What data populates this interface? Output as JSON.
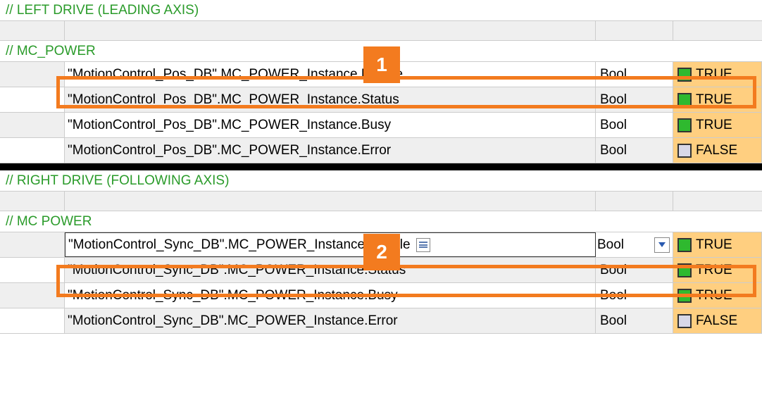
{
  "sections": {
    "left": {
      "title": "// LEFT DRIVE (LEADING AXIS)",
      "group_label": "// MC_POWER",
      "rows": [
        {
          "name": "\"MotionControl_Pos_DB\".MC_POWER_Instance.Enable",
          "type": "Bool",
          "value": "TRUE",
          "state": true
        },
        {
          "name": "\"MotionControl_Pos_DB\".MC_POWER_Instance.Status",
          "type": "Bool",
          "value": "TRUE",
          "state": true
        },
        {
          "name": "\"MotionControl_Pos_DB\".MC_POWER_Instance.Busy",
          "type": "Bool",
          "value": "TRUE",
          "state": true
        },
        {
          "name": "\"MotionControl_Pos_DB\".MC_POWER_Instance.Error",
          "type": "Bool",
          "value": "FALSE",
          "state": false
        }
      ]
    },
    "right": {
      "title": "// RIGHT DRIVE (FOLLOWING AXIS)",
      "group_label": "// MC POWER",
      "rows": [
        {
          "name": "\"MotionControl_Sync_DB\".MC_POWER_Instance.Enable",
          "type": "Bool",
          "value": "TRUE",
          "state": true
        },
        {
          "name": "\"MotionControl_Sync_DB\".MC_POWER_Instance.Status",
          "type": "Bool",
          "value": "TRUE",
          "state": true
        },
        {
          "name": "\"MotionControl_Sync_DB\".MC_POWER_Instance.Busy",
          "type": "Bool",
          "value": "TRUE",
          "state": true
        },
        {
          "name": "\"MotionControl_Sync_DB\".MC_POWER_Instance.Error",
          "type": "Bool",
          "value": "FALSE",
          "state": false
        }
      ]
    }
  },
  "annotations": {
    "a1": "1",
    "a2": "2"
  }
}
